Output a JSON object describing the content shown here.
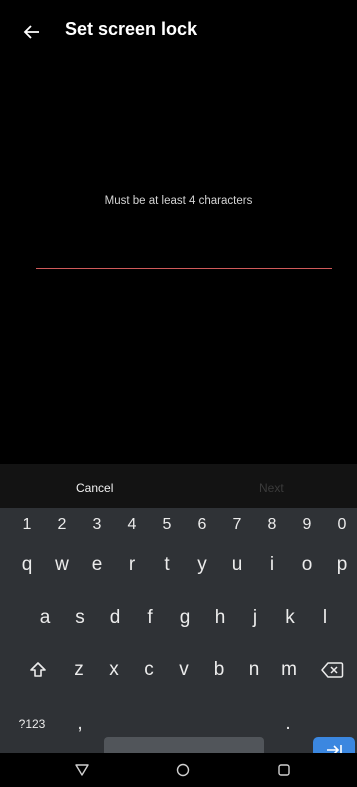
{
  "header": {
    "title": "Set screen lock",
    "back_icon": "arrow-left-icon"
  },
  "content": {
    "hint": "Must be at least 4 characters",
    "password_value": ""
  },
  "actions": {
    "cancel_label": "Cancel",
    "next_label": "Next"
  },
  "keyboard": {
    "numbers": [
      "1",
      "2",
      "3",
      "4",
      "5",
      "6",
      "7",
      "8",
      "9",
      "0"
    ],
    "row1": [
      "q",
      "w",
      "e",
      "r",
      "t",
      "y",
      "u",
      "i",
      "o",
      "p"
    ],
    "row2": [
      "a",
      "s",
      "d",
      "f",
      "g",
      "h",
      "j",
      "k",
      "l"
    ],
    "row3": [
      "z",
      "x",
      "c",
      "v",
      "b",
      "n",
      "m"
    ],
    "symbols_label": "?123",
    "comma_label": ",",
    "period_label": "."
  },
  "colors": {
    "background": "#000000",
    "keyboard": "#2f3236",
    "accent": "#3b87e0",
    "field_underline": "#d05a5a"
  },
  "navigation": {
    "back_icon": "triangle-back-icon",
    "home_icon": "circle-home-icon",
    "recents_icon": "square-recents-icon"
  }
}
